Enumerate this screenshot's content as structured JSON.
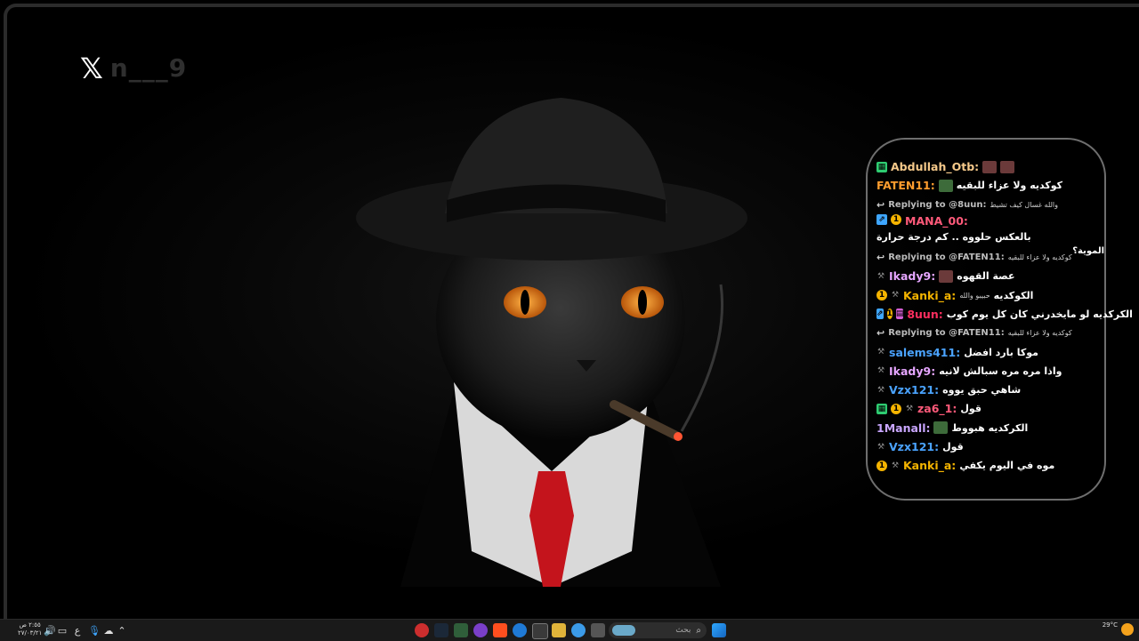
{
  "overlay_handle": {
    "logo": "𝕏",
    "name": "n___9"
  },
  "chat": {
    "messages": [
      {
        "user": "Abdullah_Otb:",
        "user_color": "#f5c98a",
        "text": "",
        "badges": [
          "green"
        ],
        "emotes": [
          "r",
          "r"
        ]
      },
      {
        "user": "FATEN11:",
        "user_color": "#ff9d2e",
        "text": "كوكديه ولا عزاء للبقيه",
        "badges": [],
        "emotes": [
          "g"
        ]
      },
      {
        "reply": true,
        "label": "Replying to @8uun:",
        "text": "والله غسال كيف تشيط"
      },
      {
        "user": "MANA_00:",
        "user_color": "#ff5a7a",
        "text": "بالعكس حلووه .. كم درجة حرارة",
        "wrap": "الموية؟",
        "badges": [
          "sub",
          "gold"
        ],
        "tall": true
      },
      {
        "reply": true,
        "label": "Replying to @FATEN11:",
        "text": "كوكديه ولا عزاء للبقيه"
      },
      {
        "user": "Ikady9:",
        "user_color": "#e6a6ff",
        "text": "عصة القهوه",
        "badges": [
          "mod"
        ],
        "emotes": [
          "r"
        ]
      },
      {
        "user": "Kanki_a:",
        "user_color": "#f5b400",
        "text": "الكوكديه",
        "subtext": "حبيبو والله",
        "badges": [
          "gold",
          "mod"
        ]
      },
      {
        "user": "8uun:",
        "user_color": "#ff2e5f",
        "text": "الكركديه لو مايخدرني كان كل يوم كوب",
        "badges": [
          "sub",
          "gold",
          "gift"
        ]
      },
      {
        "reply": true,
        "label": "Replying to @FATEN11:",
        "text": "كوكديه ولا عزاء للبقيه"
      },
      {
        "user": "salems411:",
        "user_color": "#4aa3ff",
        "text": "موكا بارد افضل",
        "badges": [
          "mod"
        ]
      },
      {
        "user": "Ikady9:",
        "user_color": "#e6a6ff",
        "text": "واذا مره مره سبالش لانيه",
        "badges": [
          "mod"
        ]
      },
      {
        "user": "Vzx121:",
        "user_color": "#4aa3ff",
        "text": "شاهي حبق يووه",
        "badges": [
          "mod"
        ]
      },
      {
        "user": "za6_1:",
        "user_color": "#ff5a7a",
        "text": "قول",
        "badges": [
          "green",
          "gold",
          "mod"
        ]
      },
      {
        "user": "1Manall:",
        "user_color": "#c9a6ff",
        "text": "الكركديه هبووط",
        "badges": [],
        "emotes": [
          "g"
        ]
      },
      {
        "user": "Vzx121:",
        "user_color": "#4aa3ff",
        "text": "قول",
        "badges": [
          "mod"
        ]
      },
      {
        "user": "Kanki_a:",
        "user_color": "#f5b400",
        "text": "موه في اليوم يكفي",
        "badges": [
          "gold",
          "mod"
        ]
      }
    ]
  },
  "taskbar": {
    "search_placeholder": "بحث",
    "clock_time": "٢:٥٥ ص",
    "clock_date": "٢٧/٠٣/٢١",
    "lang": "ع",
    "weather_temp": "29°C"
  },
  "colors": {
    "accent": "#3ea6ff",
    "chat_border": "#6e6e6e",
    "tie": "#c4141c"
  }
}
